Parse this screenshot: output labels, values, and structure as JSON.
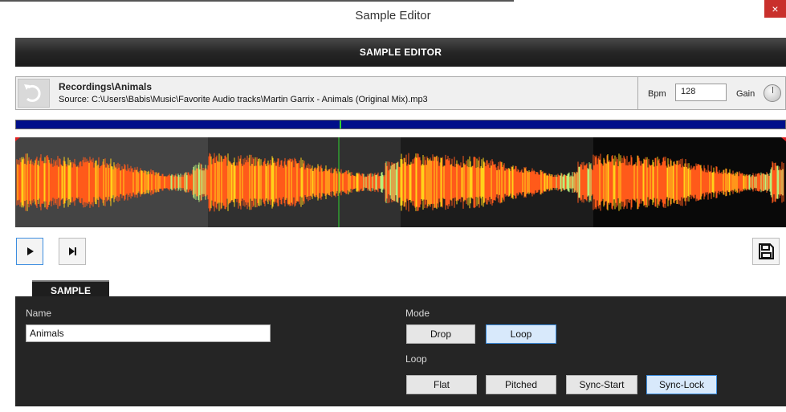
{
  "window": {
    "title": "Sample Editor",
    "close_glyph": "×"
  },
  "header": {
    "title": "SAMPLE EDITOR"
  },
  "info": {
    "undo_icon": "undo-icon",
    "title": "Recordings\\Animals",
    "source": "Source: C:\\Users\\Babis\\Music\\Favorite Audio tracks\\Martin Garrix - Animals (Original Mix).mp3",
    "bpm_label": "Bpm",
    "bpm_value": "128",
    "gain_label": "Gain"
  },
  "transport": {
    "play_icon": "play-icon",
    "next_icon": "skip-next-icon",
    "save_icon": "save-icon"
  },
  "tabs": {
    "sample_label": "SAMPLE"
  },
  "sample": {
    "name_label": "Name",
    "name_value": "Animals",
    "mode_label": "Mode",
    "mode_buttons": [
      {
        "label": "Drop",
        "active": false
      },
      {
        "label": "Loop",
        "active": true
      }
    ],
    "loop_label": "Loop",
    "loop_buttons": [
      {
        "label": "Flat",
        "active": false
      },
      {
        "label": "Pitched",
        "active": false
      },
      {
        "label": "Sync-Start",
        "active": false
      },
      {
        "label": "Sync-Lock",
        "active": true
      }
    ]
  },
  "colors": {
    "wave_orange": "#ff5a1a",
    "wave_yellow": "#ffd21a",
    "wave_green": "#b8f07a",
    "cursor": "#2fd42f",
    "overview_blue": "#000f8a",
    "active_button": "#d8e9fb"
  },
  "playhead_fraction": 0.42
}
